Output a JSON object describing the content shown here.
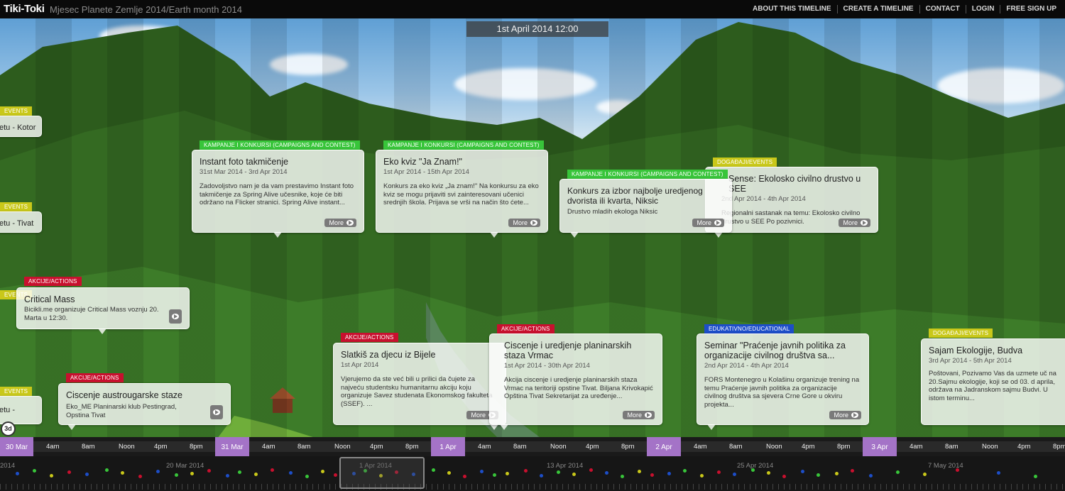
{
  "header": {
    "logo": "Tiki-Toki",
    "title": "Mjesec Planete Zemlje 2014/Earth month 2014",
    "nav": [
      "ABOUT THIS TIMELINE",
      "CREATE A TIMELINE",
      "CONTACT",
      "LOGIN",
      "FREE SIGN UP"
    ]
  },
  "current_date": "1st April 2014 12:00",
  "left_edge": {
    "tags": [
      "EVENTS",
      "EVENTS",
      "EVENTS",
      "EVENTS"
    ],
    "titles": [
      "etu - Kotor",
      "etu - Tivat",
      "etu -",
      "etu -"
    ]
  },
  "stories": [
    {
      "tag": "KAMPANJE I KONKURSI (CAMPAIGNS AND CONTEST)",
      "title": "Instant foto takmičenje",
      "date": "31st Mar 2014 - 3rd Apr 2014",
      "body": "Zadovoljstvo nam je da vam prestavimo Instant foto takmičenje za Spring Alive učesnike, koje će biti održano na Flicker stranici. Spring Alive instant...",
      "more": "More"
    },
    {
      "tag": "KAMPANJE I KONKURSI (CAMPAIGNS AND CONTEST)",
      "title": "Eko kviz \"Ja Znam!\"",
      "date": "1st Apr 2014 - 15th Apr 2014",
      "body": "Konkurs za eko kviz „Ja znam!\" Na konkursu za eko kviz se mogu prijaviti svi zainteresovani učenici srednjih škola. Prijava se vrši na način što ćete...",
      "more": "More"
    },
    {
      "tag": "KAMPANJE I KONKURSI (CAMPAIGNS AND CONTEST)",
      "title": "Konkurs za izbor najbolje uredjenog dvorista ili kvarta, Niksic",
      "date": "",
      "body": "Drustvo mladih ekologa Niksic",
      "more": "More"
    },
    {
      "tag": "DOGAĐAJI/EVENTS",
      "title": "Sense: Ekolosko civilno drustvo u SEE",
      "date": "2nd Apr 2014 - 4th Apr 2014",
      "body": "Regionalni sastanak na temu: Ekolosko civilno drustvo u SEE Po pozivnici.",
      "more": "More"
    },
    {
      "tag": "AKCIJE/ACTIONS",
      "title": "Critical Mass",
      "date": "",
      "body": "Bicikli.me organizuje Critical Mass voznju 20. Marta u 12:30.",
      "more": ""
    },
    {
      "tag": "AKCIJE/ACTIONS",
      "title": "Ciscenje austrougarske staze",
      "date": "",
      "body": "Eko_ME Planinarski klub Pestingrad, Opstina Tivat",
      "more": ""
    },
    {
      "tag": "AKCIJE/ACTIONS",
      "title": "Slatkiš za djecu iz Bijele",
      "date": "1st Apr 2014",
      "body": "Vjerujemo da ste već bili u prilici da čujete za najveću studentsku humanitarnu akciju koju organizuje Savez studenata Ekonomskog fakulteta (SSEF). ...",
      "more": "More"
    },
    {
      "tag": "AKCIJE/ACTIONS",
      "title": "Ciscenje i uredjenje planinarskih staza Vrmac",
      "date": "1st Apr 2014 - 30th Apr 2014",
      "body": "Akcija ciscenje i uredjenje planinarskih staza Vrmac na teritoriji opstine Tivat. Biljana Krivokapić Opština Tivat Sekretarijat za uređenje...",
      "more": "More"
    },
    {
      "tag": "EDUKATIVNO/EDUCATIONAL",
      "title": "Seminar \"Praćenje javnih politika za organizacije civilnog društva sa...",
      "date": "2nd Apr 2014 - 4th Apr 2014",
      "body": "FORS Montenegro u Kolašinu organizuje trening na temu Praćenje javnih politika za organizacije civilnog društva sa sjevera Crne Gore u okviru projekta...",
      "more": "More"
    },
    {
      "tag": "DOGAĐAJI/EVENTS",
      "title": "Sajam Ekologije, Budva",
      "date": "3rd Apr 2014 - 5th Apr 2014",
      "body": "Poštovani, Pozivamo Vas da uzmete uč na 20.Sajmu ekologije, koji se od 03. d aprila, održava na Jadranskom sajmu Budvi. U istom terminu...",
      "more": ""
    }
  ],
  "zoom_label": "3d",
  "axis": {
    "days": [
      "30 Mar",
      "31 Mar",
      "1 Apr",
      "2 Apr",
      "3 Apr"
    ],
    "hours": [
      "4am",
      "8am",
      "Noon",
      "4pm",
      "8pm"
    ]
  },
  "navigator": {
    "dates": [
      "2014",
      "20 Mar 2014",
      "1 Apr 2014",
      "13 Apr 2014",
      "25 Apr 2014",
      "7 May 2014"
    ]
  },
  "colors": {
    "campaigns": "#38c53a",
    "actions": "#c8102e",
    "events": "#c9c81a",
    "educational": "#1d4ec8",
    "day_marker": "#a473c7"
  }
}
